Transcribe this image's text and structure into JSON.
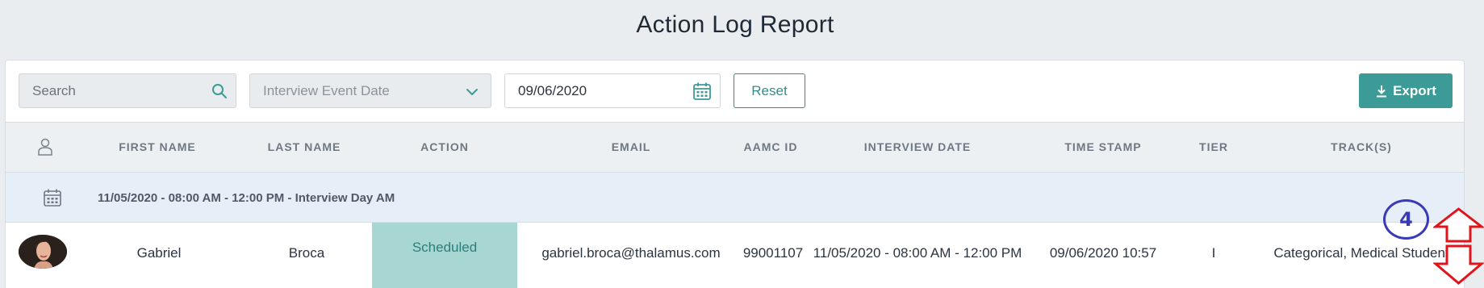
{
  "page": {
    "title": "Action Log Report"
  },
  "toolbar": {
    "search_placeholder": "Search",
    "event_select_label": "Interview Event Date",
    "date_value": "09/06/2020",
    "reset_label": "Reset",
    "export_label": "Export"
  },
  "table": {
    "columns": [
      "FIRST NAME",
      "LAST NAME",
      "ACTION",
      "EMAIL",
      "AAMC ID",
      "INTERVIEW DATE",
      "TIME STAMP",
      "TIER",
      "TRACK(S)"
    ],
    "group_label": "11/05/2020 - 08:00 AM - 12:00 PM - Interview Day AM",
    "rows": [
      {
        "first_name": "Gabriel",
        "last_name": "Broca",
        "action": "Scheduled",
        "email": "gabriel.broca@thalamus.com",
        "aamc_id": "99001107",
        "interview_date": "11/05/2020 - 08:00 AM - 12:00 PM",
        "time_stamp": "09/06/2020 10:57",
        "tier": "I",
        "tracks": "Categorical, Medical Student"
      }
    ]
  },
  "annotation": {
    "step_number": "4",
    "color": "#3a3ab8",
    "arrow_color": "#e0141a"
  },
  "colors": {
    "accent": "#3c9b97",
    "status_bg": "#a8d6d3",
    "group_bg": "#e6eef8"
  }
}
